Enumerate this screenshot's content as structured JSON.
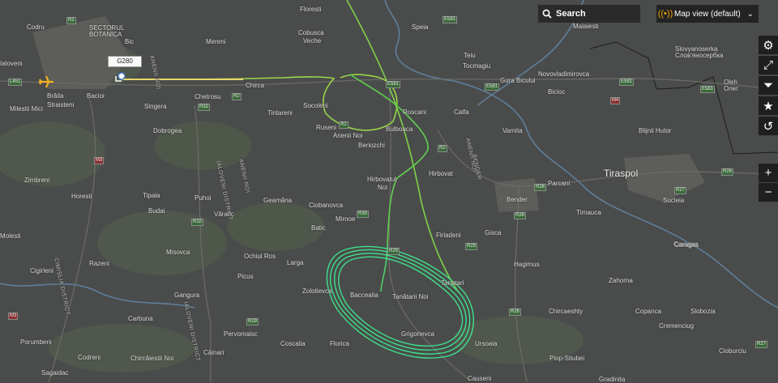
{
  "search": {
    "label": "Search",
    "icon": "search-icon"
  },
  "map_view": {
    "label": "Map view (default)",
    "icon": "signal-icon"
  },
  "side_toolbar": [
    {
      "name": "settings-button",
      "icon": "gear-icon",
      "glyph": "⚙"
    },
    {
      "name": "fullscreen-button",
      "icon": "fullscreen-icon",
      "glyph": "⤢"
    },
    {
      "name": "filter-button",
      "icon": "filter-icon",
      "glyph": "⏷"
    },
    {
      "name": "favorites-button",
      "icon": "star-icon",
      "glyph": "★"
    },
    {
      "name": "playback-button",
      "icon": "history-icon",
      "glyph": "↺"
    }
  ],
  "zoom": {
    "in": "+",
    "out": "−"
  },
  "aircraft": {
    "callsign": "G280"
  },
  "places": [
    [
      "Codru",
      33,
      29
    ],
    [
      "SECTORUL",
      110,
      30
    ],
    [
      "BOTANICA",
      110,
      38
    ],
    [
      "Bic",
      154,
      47
    ],
    [
      "Mereni",
      254,
      47
    ],
    [
      "Cobusca",
      368,
      36
    ],
    [
      "Veche",
      374,
      46
    ],
    [
      "Floresti",
      370,
      7
    ],
    [
      "Speia",
      508,
      29
    ],
    [
      "Teiu",
      572,
      64
    ],
    [
      "Tocmagiu",
      571,
      77
    ],
    [
      "Malaiesti",
      707,
      28
    ],
    [
      "Slovyanoserka",
      833,
      56
    ],
    [
      "Слов'яносербка",
      833,
      64
    ],
    [
      "Novovladimirovca",
      664,
      87
    ],
    [
      "Gura Bicului",
      617,
      95
    ],
    [
      "Bicioc",
      676,
      109
    ],
    [
      "Oleh",
      893,
      97
    ],
    [
      "Олег",
      893,
      105
    ],
    [
      "Ialoveni",
      0,
      74
    ],
    [
      "Bacioi",
      107,
      114
    ],
    [
      "Singera",
      178,
      127
    ],
    [
      "Chetrosu",
      240,
      115
    ],
    [
      "Chirca",
      303,
      101
    ],
    [
      "Brăila",
      58,
      114
    ],
    [
      "Straisteni",
      58,
      125
    ],
    [
      "Milestii Mici",
      12,
      130
    ],
    [
      "Tintareni",
      330,
      135
    ],
    [
      "Socoleni",
      374,
      126
    ],
    [
      "Roscani",
      497,
      134
    ],
    [
      "Calfa",
      560,
      134
    ],
    [
      "Ruseni",
      390,
      153
    ],
    [
      "Anenii Noi",
      411,
      163
    ],
    [
      "Bulboaca",
      476,
      155
    ],
    [
      "Varnita",
      620,
      157
    ],
    [
      "Blijnii Hutor",
      788,
      157
    ],
    [
      "Dobrogea",
      189,
      157
    ],
    [
      "Beriozchi",
      442,
      175
    ],
    [
      "Hirbovat",
      529,
      210
    ],
    [
      "Hirbovatul",
      453,
      217
    ],
    [
      "Noi",
      466,
      227
    ],
    [
      "Parcani",
      676,
      222
    ],
    [
      "Zimbreni",
      30,
      218
    ],
    [
      "Horesti",
      88,
      238
    ],
    [
      "Tipala",
      176,
      237
    ],
    [
      "Puhoi",
      240,
      240
    ],
    [
      "Geamăna",
      325,
      243
    ],
    [
      "Ciobanovca",
      381,
      249
    ],
    [
      "Bender",
      625,
      242
    ],
    [
      "Sucleia",
      818,
      243
    ],
    [
      "Budai",
      183,
      256
    ],
    [
      "Văratic",
      264,
      260
    ],
    [
      "Mirnoe",
      414,
      266
    ],
    [
      "Tirnauca",
      711,
      258
    ],
    [
      "Batic",
      384,
      277
    ],
    [
      "Firladeni",
      538,
      286
    ],
    [
      "Gisca",
      598,
      283
    ],
    [
      "Molesti",
      0,
      287
    ],
    [
      "Caragas",
      831,
      297
    ],
    [
      "Misovca",
      205,
      307
    ],
    [
      "Ochiul Ros",
      301,
      312
    ],
    [
      "Larga",
      354,
      320
    ],
    [
      "Hagimus",
      634,
      322
    ],
    [
      "Razeni",
      110,
      321
    ],
    [
      "Cigirleni",
      37,
      330
    ],
    [
      "Picus",
      293,
      337
    ],
    [
      "Zahorna",
      751,
      342
    ],
    [
      "Tanatari",
      544,
      345
    ],
    [
      "Zolotievca",
      373,
      355
    ],
    [
      "Baccealia",
      432,
      360
    ],
    [
      "Tanătarii Noi",
      484,
      362
    ],
    [
      "Gangura",
      215,
      360
    ],
    [
      "Chircaeshty",
      677,
      380
    ],
    [
      "Copanca",
      784,
      380
    ],
    [
      "Slobozia",
      852,
      380
    ],
    [
      "Carbuna",
      158,
      389
    ],
    [
      "Caragas",
      832,
      298
    ],
    [
      "Pervomaisc",
      276,
      408
    ],
    [
      "Coscalia",
      346,
      420
    ],
    [
      "Florica",
      407,
      420
    ],
    [
      "Grigorievca",
      495,
      408
    ],
    [
      "Ursoaia",
      586,
      420
    ],
    [
      "Cremenciug",
      813,
      398
    ],
    [
      "Porumbeni",
      25,
      418
    ],
    [
      "Codreni",
      96,
      437
    ],
    [
      "Chircăiestii Noi",
      161,
      438
    ],
    [
      "Căinari",
      251,
      431
    ],
    [
      "Plop-Stiubei",
      678,
      438
    ],
    [
      "Sagaidac",
      51,
      456
    ],
    [
      "Cioburciu",
      887,
      429
    ],
    [
      "Causeni",
      577,
      463
    ],
    [
      "Gradinita",
      739,
      464
    ]
  ],
  "cities": [
    [
      "Tiraspol",
      745,
      207
    ]
  ],
  "roads": [
    [
      "R2",
      82,
      21,
      "g"
    ],
    [
      "E581",
      546,
      20,
      "g"
    ],
    [
      "E581",
      476,
      100,
      "g"
    ],
    [
      "E581",
      598,
      103,
      "g"
    ],
    [
      "E581",
      764,
      97,
      "g"
    ],
    [
      "E581",
      864,
      106,
      "g"
    ],
    [
      "L451",
      10,
      97,
      "g"
    ],
    [
      "M4",
      753,
      120,
      "r"
    ],
    [
      "R2",
      286,
      115,
      "g"
    ],
    [
      "R32",
      244,
      128,
      "g"
    ],
    [
      "R2",
      418,
      150,
      "g"
    ],
    [
      "R2",
      540,
      179,
      "g"
    ],
    [
      "M3",
      116,
      194,
      "r"
    ],
    [
      "R26",
      659,
      227,
      "g"
    ],
    [
      "R26",
      890,
      208,
      "g"
    ],
    [
      "R26",
      634,
      262,
      "g"
    ],
    [
      "R27",
      832,
      231,
      "g"
    ],
    [
      "R32",
      236,
      270,
      "g"
    ],
    [
      "R30",
      440,
      260,
      "g"
    ],
    [
      "R29",
      574,
      300,
      "g"
    ],
    [
      "R29",
      478,
      306,
      "g"
    ],
    [
      "M3",
      10,
      386,
      "r"
    ],
    [
      "R29",
      304,
      393,
      "g"
    ],
    [
      "R26",
      628,
      381,
      "g"
    ],
    [
      "R27",
      932,
      421,
      "g"
    ]
  ],
  "districts": [
    [
      "ANENII NOI",
      190,
      68
    ],
    [
      "IALOVENI DISTRICT",
      272,
      198
    ],
    [
      "ANENII NOI",
      300,
      196
    ],
    [
      "ANENII NOI",
      580,
      170
    ],
    [
      "BENDER",
      588,
      190
    ],
    [
      "CIMIȘLIA DISTRICT",
      72,
      318
    ],
    [
      "IALOVENI DISTRICT",
      232,
      372
    ]
  ]
}
